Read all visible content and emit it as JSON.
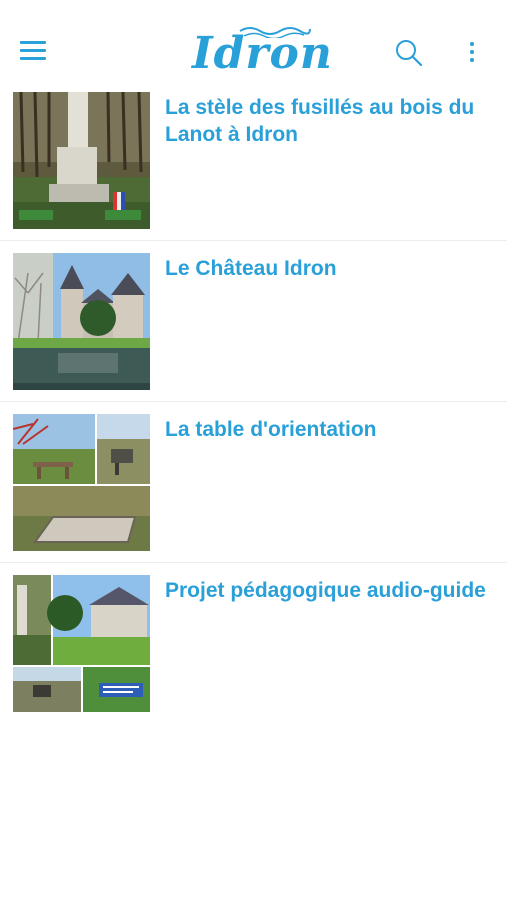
{
  "header": {
    "logo_text": "Idron",
    "menu_icon": "hamburger-menu-icon",
    "search_icon": "search-icon",
    "more_icon": "more-vertical-icon"
  },
  "colors": {
    "accent": "#2aa0d8",
    "background": "#ffffff",
    "divider": "#ececec"
  },
  "items": [
    {
      "title": "La stèle des fusillés au bois du Lanot à Idron"
    },
    {
      "title": "Le Château Idron"
    },
    {
      "title": "La table d'orientation"
    },
    {
      "title": "Projet pédagogique audio-guide"
    }
  ]
}
